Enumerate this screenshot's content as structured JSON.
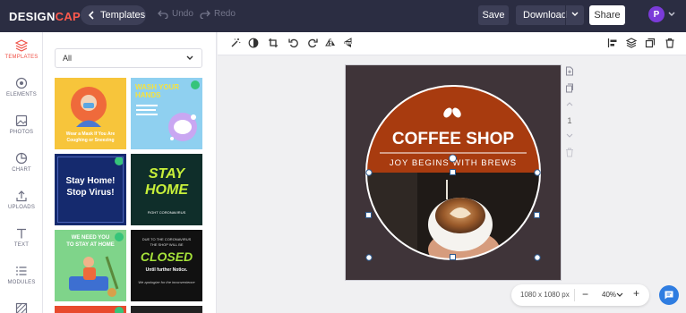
{
  "app": {
    "logo_text_a": "DESIGN",
    "logo_text_b": "CAP",
    "templates_label": "Templates",
    "undo_label": "Undo",
    "redo_label": "Redo",
    "save_label": "Save",
    "download_label": "Download",
    "share_label": "Share",
    "avatar_letter": "P"
  },
  "rail": {
    "items": [
      {
        "label": "TEMPLATES",
        "icon": "layers-icon"
      },
      {
        "label": "ELEMENTS",
        "icon": "elements-icon"
      },
      {
        "label": "PHOTOS",
        "icon": "image-icon"
      },
      {
        "label": "CHART",
        "icon": "pie-chart-icon"
      },
      {
        "label": "UPLOADS",
        "icon": "upload-icon"
      },
      {
        "label": "TEXT",
        "icon": "text-icon"
      },
      {
        "label": "MODULES",
        "icon": "list-icon"
      }
    ]
  },
  "panel": {
    "filter_value": "All",
    "thumbs": [
      {
        "line1": "Wear a Mask If You Are",
        "line2": "Coughing or Sneezing"
      },
      {
        "line1": "WASH YOUR",
        "line2": "HANDS"
      },
      {
        "line1": "Stay Home!",
        "line2": "Stop Virus!"
      },
      {
        "line1": "STAY",
        "line2": "HOME",
        "line3": "FIGHT CORONAVIRUS"
      },
      {
        "line1": "WE NEED YOU",
        "line2": "TO STAY AT HOME"
      },
      {
        "line1": "DUE TO THE CORONAVIRUS",
        "line2": "THE SHOP WILL BE",
        "line3": "CLOSED",
        "line4": "Until further Notice.",
        "line5": "We apologize for the inconvenience"
      }
    ]
  },
  "design": {
    "title": "COFFEE SHOP",
    "subtitle": "JOY BEGINS WITH BREWS"
  },
  "pager": {
    "page": "1"
  },
  "zoombar": {
    "size": "1080 x 1080 px",
    "zoom": "40%",
    "minus": "−",
    "plus": "+"
  },
  "colors": {
    "topbar": "#2b2d42",
    "accent": "#ef4f45",
    "coffee_orange": "#a83b0f",
    "canvas_bg": "#3f3439"
  }
}
